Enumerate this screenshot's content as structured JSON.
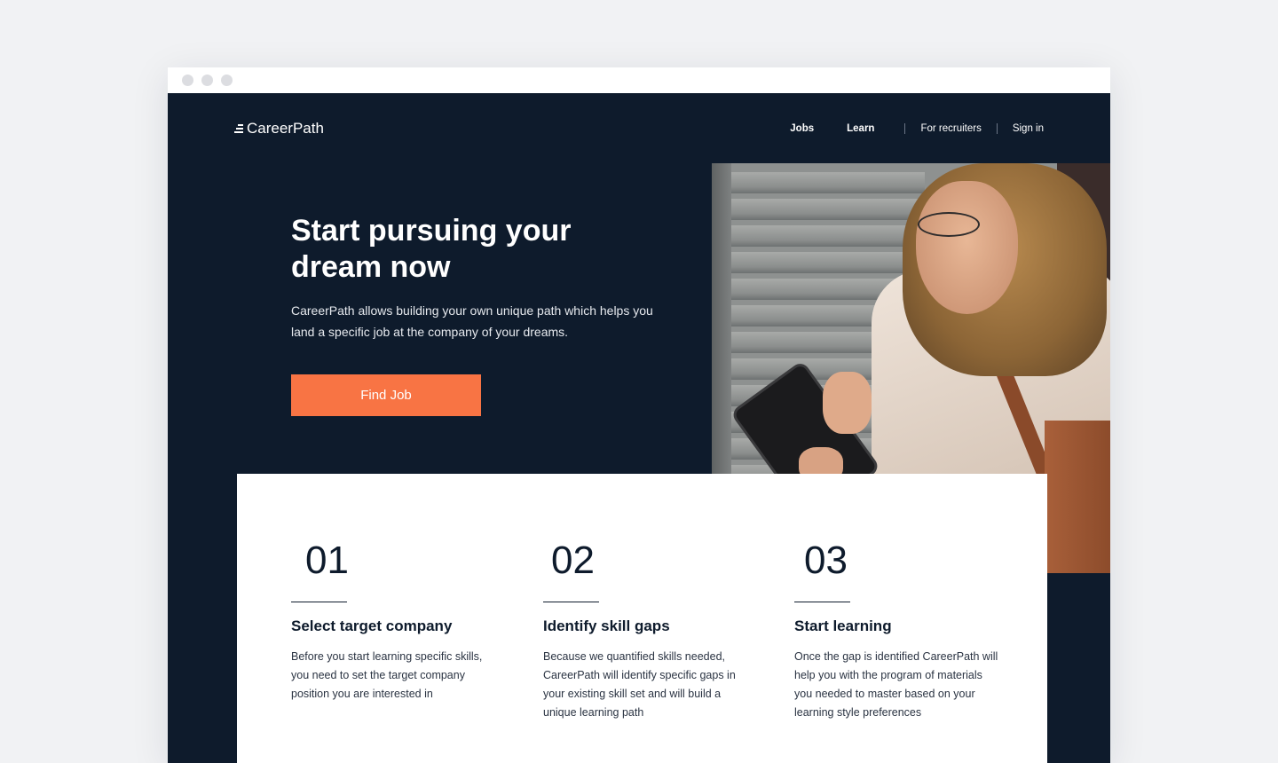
{
  "app": {
    "logo_text": "CareerPath"
  },
  "nav": {
    "jobs": "Jobs",
    "learn": "Learn",
    "recruiters": "For recruiters",
    "sign_in": "Sign in"
  },
  "hero": {
    "title": "Start pursuing your dream now",
    "text": "CareerPath allows building your own unique path which helps you land a specific job at the company of your dreams.",
    "cta": "Find Job",
    "image": "woman-with-tablet-photo"
  },
  "steps": [
    {
      "number": "01",
      "title": "Select target company",
      "text": "Before you start learning specific skills, you need to set the target company position you are interested in"
    },
    {
      "number": "02",
      "title": "Identify skill gaps",
      "text": "Because we quantified skills needed, CareerPath will identify specific gaps in your existing skill set and will build a unique learning path"
    },
    {
      "number": "03",
      "title": "Start learning",
      "text": "Once the gap is identified CareerPath will help you with the program of materials you needed to master based on your learning style preferences"
    }
  ],
  "colors": {
    "background": "#f1f2f4",
    "navy": "#0e1b2c",
    "accent": "#f87444",
    "white": "#ffffff"
  }
}
